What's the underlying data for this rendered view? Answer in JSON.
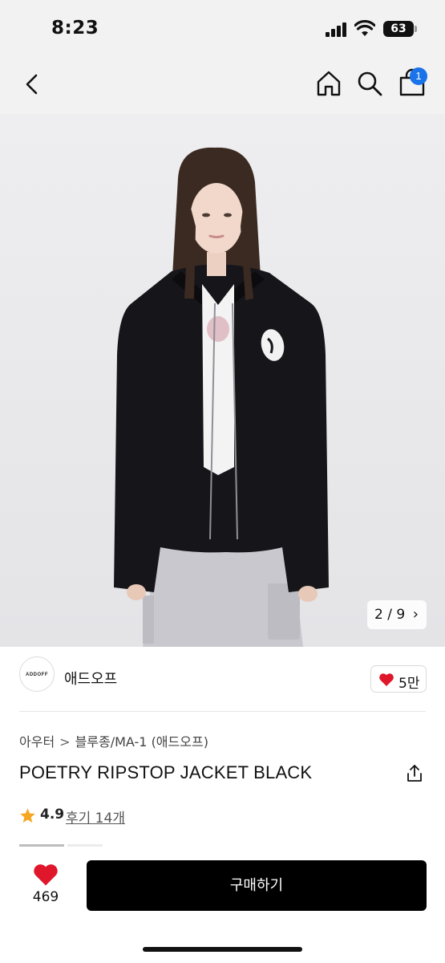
{
  "status_bar": {
    "time": "8:23",
    "battery": "63",
    "icons": [
      "signal-icon",
      "wifi-icon",
      "battery-icon"
    ]
  },
  "nav": {
    "icons": [
      "back-arrow-icon",
      "home-icon",
      "search-icon",
      "shopping-bag-icon"
    ],
    "cart_badge": "1",
    "badge_color": "#1a73e8"
  },
  "gallery": {
    "counter": "2 / 9",
    "counter_icon": "chevron-right-icon"
  },
  "brand": {
    "logo_text": "ADDOFF",
    "name": "애드오프",
    "likes": "5만",
    "like_icon": "heart-icon",
    "like_color": "#e0162b"
  },
  "product": {
    "breadcrumb": [
      "아우터",
      "블루종/MA-1 (애드오프)"
    ],
    "breadcrumb_separator": ">",
    "title": "POETRY RIPSTOP JACKET BLACK",
    "share_icon": "share-icon",
    "rating": "4.9",
    "rating_icon": "star-icon",
    "star_color": "#f5a623",
    "reviews": "후기 14개"
  },
  "bottom_bar": {
    "wish_count": "469",
    "wish_icon": "heart-icon",
    "buy_label": "구매하기",
    "buy_color": "#000000"
  }
}
